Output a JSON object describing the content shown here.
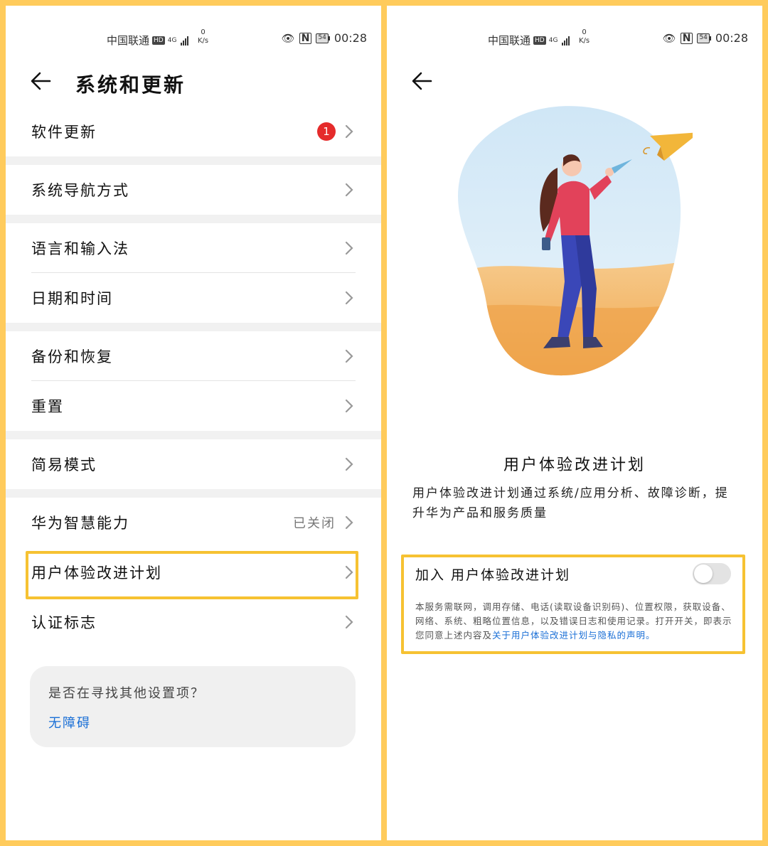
{
  "status_bar": {
    "carrier": "中国联通",
    "hd": "HD",
    "network": "4G",
    "speed_value": "0",
    "speed_unit": "K/s",
    "battery": "54",
    "time": "00:28"
  },
  "left": {
    "title": "系统和更新",
    "badge_count": "1",
    "items": [
      {
        "label": "软件更新"
      },
      {
        "label": "系统导航方式"
      },
      {
        "label": "语言和输入法"
      },
      {
        "label": "日期和时间"
      },
      {
        "label": "备份和恢复"
      },
      {
        "label": "重置"
      },
      {
        "label": "简易模式"
      },
      {
        "label": "华为智慧能力",
        "status": "已关闭"
      },
      {
        "label": "用户体验改进计划"
      },
      {
        "label": "认证标志"
      }
    ],
    "card": {
      "question": "是否在寻找其他设置项？",
      "link": "无障碍"
    }
  },
  "right": {
    "title": "用户体验改进计划",
    "description": "用户体验改进计划通过系统/应用分析、故障诊断，提升华为产品和服务质量",
    "join_label": "加入 用户体验改进计划",
    "toggle_on": false,
    "fine_print": "本服务需联网，调用存储、电话(读取设备识别码)、位置权限，获取设备、网络、系统、粗略位置信息，以及错误日志和使用记录。打开开关，即表示您同意上述内容及",
    "fine_print_link": "关于用户体验改进计划与隐私的声明。"
  },
  "colors": {
    "frame": "#ffcb5c",
    "highlight": "#f6c232",
    "link": "#1a6fd6",
    "badge": "#e52b2b"
  }
}
